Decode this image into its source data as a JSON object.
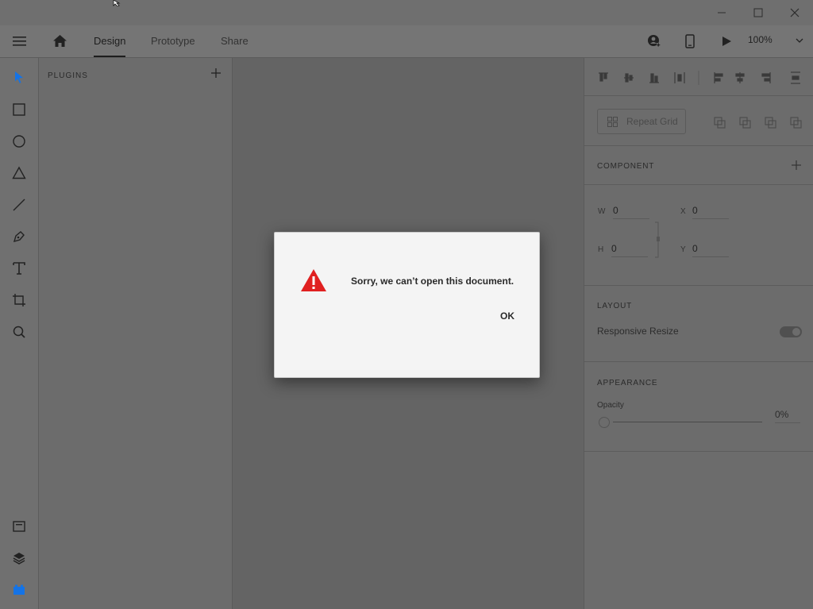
{
  "window": {
    "controls": [
      "minimize",
      "maximize",
      "close"
    ]
  },
  "header": {
    "tabs": [
      {
        "label": "Design",
        "active": true
      },
      {
        "label": "Prototype",
        "active": false
      },
      {
        "label": "Share",
        "active": false
      }
    ],
    "zoom": "100%"
  },
  "toolbar": {
    "tools": [
      "select-icon",
      "rectangle-icon",
      "ellipse-icon",
      "polygon-icon",
      "line-icon",
      "pen-icon",
      "text-icon",
      "artboard-icon",
      "zoom-icon"
    ],
    "bottom": [
      "document-assets-icon",
      "layers-icon",
      "plugins-icon"
    ],
    "accent": "#1473e6"
  },
  "plugins_panel": {
    "title": "PLUGINS"
  },
  "properties": {
    "repeat_grid": "Repeat Grid",
    "component_title": "COMPONENT",
    "w_label": "W",
    "w_value": "0",
    "h_label": "H",
    "h_value": "0",
    "x_label": "X",
    "x_value": "0",
    "y_label": "Y",
    "y_value": "0",
    "layout_title": "LAYOUT",
    "responsive_resize": "Responsive Resize",
    "appearance_title": "APPEARANCE",
    "opacity_label": "Opacity",
    "opacity_value": "0%"
  },
  "dialog": {
    "message": "Sorry, we can’t open this document.",
    "ok_label": "OK",
    "icon": "warning-icon",
    "icon_color": "#e02020"
  }
}
